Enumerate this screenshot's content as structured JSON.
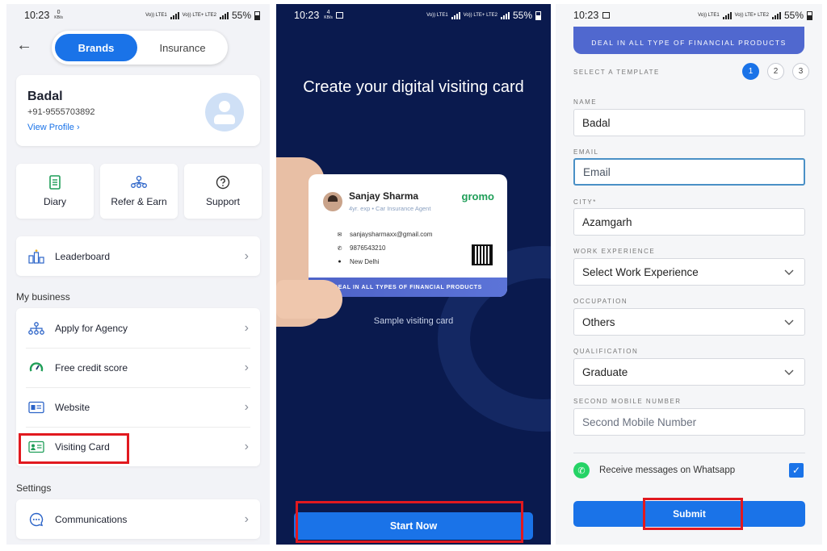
{
  "status_bars": [
    {
      "time": "10:23",
      "speed": "0",
      "speed_unit": "KB/s",
      "net1": "Vo)) LTE1",
      "net2": "Vo)) LTE+ LTE2",
      "battery": "55%"
    },
    {
      "time": "10:23",
      "speed": "4",
      "speed_unit": "KB/s",
      "net1": "Vo)) LTE1",
      "net2": "Vo)) LTE+ LTE2",
      "battery": "55%"
    },
    {
      "time": "10:23",
      "net1": "Vo)) LTE1",
      "net2": "Vo)) LTE+ LTE2",
      "battery": "55%"
    }
  ],
  "home": {
    "tabs": {
      "active": "Brands",
      "inactive": "Insurance"
    },
    "profile": {
      "name": "Badal",
      "phone": "+91-9555703892",
      "view_profile": "View Profile"
    },
    "tiles": [
      {
        "label": "Diary",
        "icon": "diary-icon"
      },
      {
        "label": "Refer & Earn",
        "icon": "refer-icon"
      },
      {
        "label": "Support",
        "icon": "support-icon"
      }
    ],
    "leaderboard": "Leaderboard",
    "my_business_title": "My business",
    "business_items": [
      {
        "label": "Apply for Agency",
        "icon": "agency-icon"
      },
      {
        "label": "Free credit score",
        "icon": "credit-score-icon"
      },
      {
        "label": "Website",
        "icon": "website-icon"
      },
      {
        "label": "Visiting Card",
        "icon": "visiting-card-icon"
      }
    ],
    "settings_title": "Settings",
    "settings_items": [
      {
        "label": "Communications",
        "icon": "communications-icon"
      }
    ]
  },
  "intro": {
    "title": "Create your digital visiting card",
    "card": {
      "name": "Sanjay Sharma",
      "subtitle": "4yr. exp • Car Insurance Agent",
      "brand": "gromo",
      "email": "sanjaysharmaxx@gmail.com",
      "phone": "9876543210",
      "location": "New Delhi",
      "band": "DEAL IN ALL TYPES OF FINANCIAL PRODUCTS"
    },
    "caption": "Sample visiting card",
    "cta": "Start Now"
  },
  "form": {
    "banner": "DEAL IN ALL TYPE OF FINANCIAL PRODUCTS",
    "template_label": "SELECT A TEMPLATE",
    "templates": [
      "1",
      "2",
      "3"
    ],
    "fields": {
      "name": {
        "label": "NAME",
        "value": "Badal"
      },
      "email": {
        "label": "EMAIL",
        "placeholder": "Email"
      },
      "city": {
        "label": "CITY*",
        "value": "Azamgarh"
      },
      "work_experience": {
        "label": "WORK EXPERIENCE",
        "value": "Select Work Experience"
      },
      "occupation": {
        "label": "OCCUPATION",
        "value": "Others"
      },
      "qualification": {
        "label": "QUALIFICATION",
        "value": "Graduate"
      },
      "second_mobile": {
        "label": "SECOND MOBILE NUMBER",
        "placeholder": "Second Mobile Number"
      }
    },
    "whatsapp_label": "Receive messages on Whatsapp",
    "submit": "Submit"
  },
  "colors": {
    "accent": "#1a73e8",
    "dark_bg": "#0a1a4e",
    "highlight": "#e1191f",
    "brand_green": "#1f9e58"
  }
}
